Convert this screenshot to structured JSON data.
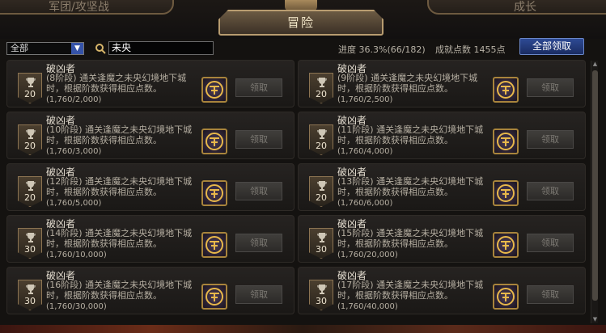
{
  "tabs": {
    "left": "军团/攻坚战",
    "center": "冒险",
    "right": "成长"
  },
  "filter": {
    "category_value": "全部",
    "search_value": "未央"
  },
  "summary": {
    "progress": "进度 36.3%(66/182)",
    "points": "成就点数 1455点",
    "claim_all": "全部领取"
  },
  "claim_label": "领取",
  "icons": {
    "search": "search-icon",
    "trophy": "trophy-icon",
    "reward": "reward-emblem-icon",
    "dropdown": "chevron-down-icon"
  },
  "colors": {
    "accent_gold": "#b89c70",
    "claim_all_blue": "#2e4a94",
    "dropdown_blue": "#3553a8"
  },
  "achievements": [
    {
      "title": "破凶者",
      "desc": "(8阶段) 通关逢魔之未央幻境地下城时，根据阶数获得相应点数。",
      "progress": "(1,760/2,000)",
      "badge": "20"
    },
    {
      "title": "破凶者",
      "desc": "(9阶段) 通关逢魔之未央幻境地下城时，根据阶数获得相应点数。",
      "progress": "(1,760/2,500)",
      "badge": "20"
    },
    {
      "title": "破凶者",
      "desc": "(10阶段) 通关逢魔之未央幻境地下城时，根据阶数获得相应点数。",
      "progress": "(1,760/3,000)",
      "badge": "20"
    },
    {
      "title": "破凶者",
      "desc": "(11阶段) 通关逢魔之未央幻境地下城时，根据阶数获得相应点数。",
      "progress": "(1,760/4,000)",
      "badge": "20"
    },
    {
      "title": "破凶者",
      "desc": "(12阶段) 通关逢魔之未央幻境地下城时，根据阶数获得相应点数。",
      "progress": "(1,760/5,000)",
      "badge": "20"
    },
    {
      "title": "破凶者",
      "desc": "(13阶段) 通关逢魔之未央幻境地下城时，根据阶数获得相应点数。",
      "progress": "(1,760/6,000)",
      "badge": "20"
    },
    {
      "title": "破凶者",
      "desc": "(14阶段) 通关逢魔之未央幻境地下城时，根据阶数获得相应点数。",
      "progress": "(1,760/10,000)",
      "badge": "30"
    },
    {
      "title": "破凶者",
      "desc": "(15阶段) 通关逢魔之未央幻境地下城时，根据阶数获得相应点数。",
      "progress": "(1,760/20,000)",
      "badge": "30"
    },
    {
      "title": "破凶者",
      "desc": "(16阶段) 通关逢魔之未央幻境地下城时，根据阶数获得相应点数。",
      "progress": "(1,760/30,000)",
      "badge": "30"
    },
    {
      "title": "破凶者",
      "desc": "(17阶段) 通关逢魔之未央幻境地下城时，根据阶数获得相应点数。",
      "progress": "(1,760/40,000)",
      "badge": "30"
    }
  ]
}
